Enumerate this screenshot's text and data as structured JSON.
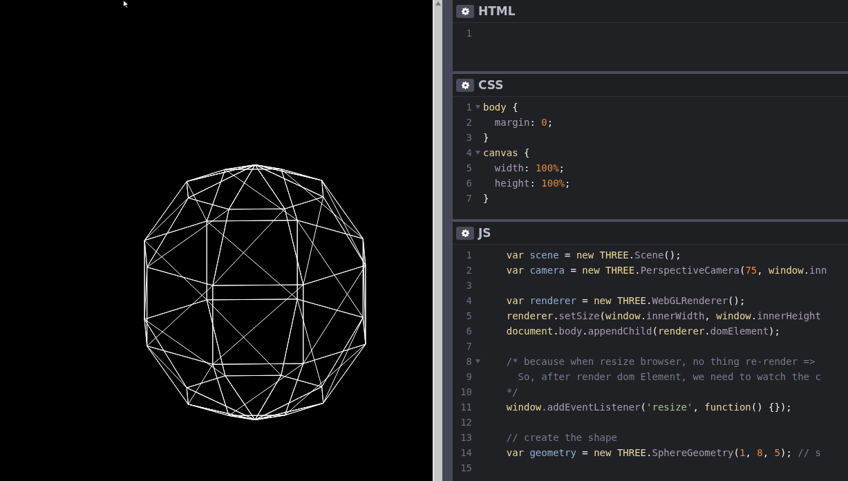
{
  "panels": [
    {
      "title": "HTML",
      "lines": [
        {
          "number": "1",
          "fold": false
        }
      ]
    },
    {
      "title": "CSS",
      "lines": [
        {
          "number": "1",
          "fold": true,
          "tokens": [
            {
              "text": "body",
              "kind": "keyword"
            },
            {
              "text": " {",
              "kind": "plain"
            }
          ]
        },
        {
          "number": "2",
          "fold": false,
          "tokens": [
            {
              "text": "  margin",
              "kind": "property"
            },
            {
              "text": ": ",
              "kind": "plain"
            },
            {
              "text": "0",
              "kind": "number"
            },
            {
              "text": ";",
              "kind": "plain"
            }
          ]
        },
        {
          "number": "3",
          "fold": false,
          "tokens": [
            {
              "text": "}",
              "kind": "plain"
            }
          ]
        },
        {
          "number": "4",
          "fold": true,
          "tokens": [
            {
              "text": "canvas",
              "kind": "keyword"
            },
            {
              "text": " {",
              "kind": "plain"
            }
          ]
        },
        {
          "number": "5",
          "fold": false,
          "tokens": [
            {
              "text": "  width",
              "kind": "property"
            },
            {
              "text": ": ",
              "kind": "plain"
            },
            {
              "text": "100%",
              "kind": "number"
            },
            {
              "text": ";",
              "kind": "plain"
            }
          ]
        },
        {
          "number": "6",
          "fold": false,
          "tokens": [
            {
              "text": "  height",
              "kind": "property"
            },
            {
              "text": ": ",
              "kind": "plain"
            },
            {
              "text": "100%",
              "kind": "number"
            },
            {
              "text": ";",
              "kind": "plain"
            }
          ]
        },
        {
          "number": "7",
          "fold": false,
          "tokens": [
            {
              "text": "}",
              "kind": "plain"
            }
          ]
        }
      ]
    },
    {
      "title": "JS",
      "lines": [
        {
          "number": "1",
          "fold": false,
          "tokens": [
            {
              "text": "    var",
              "kind": "keyword"
            },
            {
              "text": " scene",
              "kind": "def"
            },
            {
              "text": " = ",
              "kind": "plain"
            },
            {
              "text": "new",
              "kind": "keyword"
            },
            {
              "text": " THREE",
              "kind": "keyword"
            },
            {
              "text": ".",
              "kind": "plain"
            },
            {
              "text": "Scene",
              "kind": "property"
            },
            {
              "text": "();",
              "kind": "plain"
            }
          ]
        },
        {
          "number": "2",
          "fold": false,
          "tokens": [
            {
              "text": "    var",
              "kind": "keyword"
            },
            {
              "text": " camera",
              "kind": "def"
            },
            {
              "text": " = ",
              "kind": "plain"
            },
            {
              "text": "new",
              "kind": "keyword"
            },
            {
              "text": " THREE",
              "kind": "keyword"
            },
            {
              "text": ".",
              "kind": "plain"
            },
            {
              "text": "PerspectiveCamera",
              "kind": "property"
            },
            {
              "text": "(",
              "kind": "plain"
            },
            {
              "text": "75",
              "kind": "number"
            },
            {
              "text": ", ",
              "kind": "plain"
            },
            {
              "text": "window",
              "kind": "keyword"
            },
            {
              "text": ".",
              "kind": "plain"
            },
            {
              "text": "inn",
              "kind": "property"
            }
          ]
        },
        {
          "number": "3",
          "fold": false
        },
        {
          "number": "4",
          "fold": false,
          "tokens": [
            {
              "text": "    var",
              "kind": "keyword"
            },
            {
              "text": " renderer",
              "kind": "def"
            },
            {
              "text": " = ",
              "kind": "plain"
            },
            {
              "text": "new",
              "kind": "keyword"
            },
            {
              "text": " THREE",
              "kind": "keyword"
            },
            {
              "text": ".",
              "kind": "plain"
            },
            {
              "text": "WebGLRenderer",
              "kind": "property"
            },
            {
              "text": "();",
              "kind": "plain"
            }
          ]
        },
        {
          "number": "5",
          "fold": false,
          "tokens": [
            {
              "text": "    renderer",
              "kind": "keyword"
            },
            {
              "text": ".",
              "kind": "plain"
            },
            {
              "text": "setSize",
              "kind": "property"
            },
            {
              "text": "(",
              "kind": "plain"
            },
            {
              "text": "window",
              "kind": "keyword"
            },
            {
              "text": ".",
              "kind": "plain"
            },
            {
              "text": "innerWidth",
              "kind": "property"
            },
            {
              "text": ", ",
              "kind": "plain"
            },
            {
              "text": "window",
              "kind": "keyword"
            },
            {
              "text": ".",
              "kind": "plain"
            },
            {
              "text": "innerHeight",
              "kind": "property"
            }
          ]
        },
        {
          "number": "6",
          "fold": false,
          "tokens": [
            {
              "text": "    document",
              "kind": "keyword"
            },
            {
              "text": ".",
              "kind": "plain"
            },
            {
              "text": "body",
              "kind": "property"
            },
            {
              "text": ".",
              "kind": "plain"
            },
            {
              "text": "appendChild",
              "kind": "property"
            },
            {
              "text": "(",
              "kind": "plain"
            },
            {
              "text": "renderer",
              "kind": "keyword"
            },
            {
              "text": ".",
              "kind": "plain"
            },
            {
              "text": "domElement",
              "kind": "property"
            },
            {
              "text": ");",
              "kind": "plain"
            }
          ]
        },
        {
          "number": "7",
          "fold": false
        },
        {
          "number": "8",
          "fold": true,
          "tokens": [
            {
              "text": "    /* because when resize browser, no thing re-render =>",
              "kind": "comment"
            }
          ]
        },
        {
          "number": "9",
          "fold": false,
          "tokens": [
            {
              "text": "      So, after render dom Element, we need to watch the c",
              "kind": "comment"
            }
          ]
        },
        {
          "number": "10",
          "fold": false,
          "tokens": [
            {
              "text": "    */",
              "kind": "comment"
            }
          ]
        },
        {
          "number": "11",
          "fold": false,
          "tokens": [
            {
              "text": "    window",
              "kind": "keyword"
            },
            {
              "text": ".addEventListener",
              "kind": "property"
            },
            {
              "text": "(",
              "kind": "plain"
            },
            {
              "text": "'resize'",
              "kind": "string"
            },
            {
              "text": ", ",
              "kind": "plain"
            },
            {
              "text": "function",
              "kind": "keyword"
            },
            {
              "text": "() {});",
              "kind": "plain"
            }
          ]
        },
        {
          "number": "12",
          "fold": false
        },
        {
          "number": "13",
          "fold": false,
          "tokens": [
            {
              "text": "    // create the shape",
              "kind": "comment"
            }
          ]
        },
        {
          "number": "14",
          "fold": false,
          "tokens": [
            {
              "text": "    var",
              "kind": "keyword"
            },
            {
              "text": " geometry",
              "kind": "def"
            },
            {
              "text": " = ",
              "kind": "plain"
            },
            {
              "text": "new",
              "kind": "keyword"
            },
            {
              "text": " THREE",
              "kind": "keyword"
            },
            {
              "text": ".",
              "kind": "plain"
            },
            {
              "text": "SphereGeometry",
              "kind": "property"
            },
            {
              "text": "(",
              "kind": "plain"
            },
            {
              "text": "1",
              "kind": "number"
            },
            {
              "text": ", ",
              "kind": "plain"
            },
            {
              "text": "8",
              "kind": "number"
            },
            {
              "text": ", ",
              "kind": "plain"
            },
            {
              "text": "5",
              "kind": "number"
            },
            {
              "text": "); ",
              "kind": "plain"
            },
            {
              "text": "// s",
              "kind": "comment"
            }
          ]
        },
        {
          "number": "15",
          "fold": false
        }
      ]
    }
  ]
}
